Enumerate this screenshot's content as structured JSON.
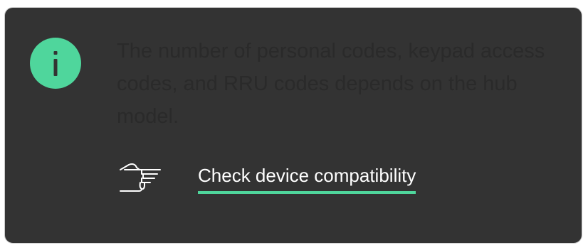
{
  "notice": {
    "icon": "info-icon",
    "message": "The number of personal codes, keypad access codes, and RRU codes depends on the hub model.",
    "link_icon": "pointing-hand-icon",
    "link_label": "Check device compatibility"
  },
  "colors": {
    "card_background": "#333333",
    "accent": "#4fd69c",
    "message_text": "#2a2a2a",
    "link_text": "#ffffff"
  }
}
